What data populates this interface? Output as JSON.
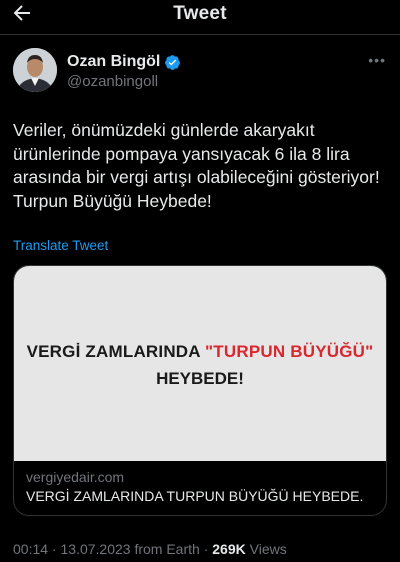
{
  "header": {
    "title": "Tweet",
    "back_icon": "arrow-left-icon"
  },
  "author": {
    "name": "Ozan Bingöl",
    "handle": "@ozanbingoll",
    "verified": true,
    "more_icon": "more-horizontal-icon"
  },
  "tweet": {
    "text": "Veriler, önümüzdeki günlerde akaryakıt ürünlerinde pompaya yansıyacak 6 ila 8 lira arasında bir vergi artışı olabileceğini gösteriyor! Turpun Büyüğü Heybede!",
    "translate_label": "Translate Tweet"
  },
  "card": {
    "image_text_prefix": "VERGİ ZAMLARINDA ",
    "image_text_highlight": "\"TURPUN BÜYÜĞÜ\"",
    "image_text_line2": "HEYBEDE!",
    "domain": "vergiyedair.com",
    "title": "VERGİ ZAMLARINDA TURPUN BÜYÜĞÜ HEYBEDE."
  },
  "meta": {
    "time": "00:14",
    "sep1": " · ",
    "date": "13.07.2023 from Earth",
    "sep2": " · ",
    "views_count": "269K",
    "views_label": " Views"
  },
  "colors": {
    "background": "#000000",
    "accent": "#1d9bf0",
    "muted": "#71767b",
    "highlight": "#d9272e"
  }
}
